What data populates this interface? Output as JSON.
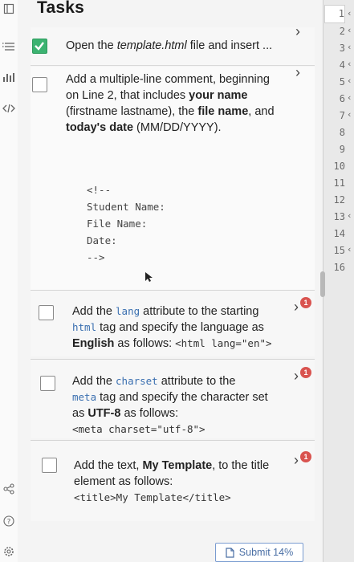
{
  "panel": {
    "title": "Tasks"
  },
  "tasks": [
    {
      "text_plain": "Open the ",
      "text_file": "template.html",
      "text_rest": " file and insert ..."
    },
    {
      "line1": "Add a multiple-line comment, beginning",
      "line2": "on Line 2, that includes ",
      "line2_bold": "your name",
      "line3_a": "(firstname lastname), the ",
      "line3_bold": "file name",
      "line3_c": ", and",
      "line4_bold": "today's date",
      "line4_c": " (MM/DD/YYYY).",
      "code": [
        "<!--",
        "Student Name:",
        "File Name:",
        "Date:",
        "-->"
      ]
    },
    {
      "a": "Add the ",
      "code1": "lang",
      "b": " attribute to the starting",
      "code2": "html",
      "c": " tag and specify the language as",
      "d_bold": "English",
      "d": " as follows: ",
      "code3": "<html lang=\"en\">"
    },
    {
      "a": "Add the ",
      "code1": "charset",
      "b": " attribute to the",
      "code2": "meta",
      "c": " tag and specify the character set",
      "d": "as ",
      "d_bold": "UTF-8",
      "d2": " as follows:",
      "code3": "<meta charset=\"utf-8\">"
    },
    {
      "a": "Add the text, ",
      "a_bold": "My Template",
      "b": ", to the title",
      "c": "element as follows:",
      "code": "<title>My Template</title>"
    }
  ],
  "badges": {
    "count": "1"
  },
  "gutter": {
    "lines": [
      "1",
      "2",
      "3",
      "4",
      "5",
      "6",
      "7",
      "8",
      "9",
      "10",
      "11",
      "12",
      "13",
      "14",
      "15",
      "16"
    ]
  },
  "submit": {
    "label": "Submit 14%"
  }
}
